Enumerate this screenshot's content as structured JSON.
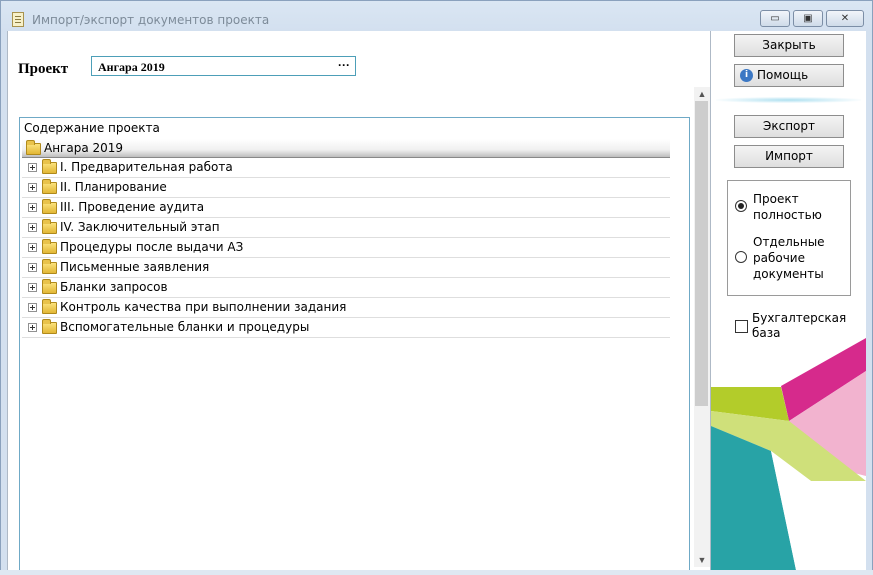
{
  "window": {
    "title": "Импорт/экспорт документов проекта",
    "controls": {
      "minimize": "▭",
      "maximize": "▣",
      "close": "✕"
    }
  },
  "project": {
    "label": "Проект",
    "value": "Ангара 2019",
    "browse": "···"
  },
  "tree": {
    "header": "Содержание проекта",
    "root": "Ангара 2019",
    "items": [
      "I. Предварительная работа",
      "II. Планирование",
      "III. Проведение аудита",
      "IV. Заключительный этап",
      "Процедуры после выдачи АЗ",
      "Письменные заявления",
      "Бланки запросов",
      "Контроль качества при выполнении задания",
      "Вспомогательные бланки  и процедуры"
    ]
  },
  "scroll": {
    "up": "▲",
    "down": "▼"
  },
  "buttons": {
    "close": "Закрыть",
    "help": "Помощь",
    "export": "Экспорт",
    "import": "Импорт"
  },
  "icons": {
    "info": "i"
  },
  "options": {
    "full_line1": "Проект",
    "full_line2": "полностью",
    "docs_line1": "Отдельные",
    "docs_line2": "рабочие",
    "docs_line3": "документы",
    "selected": "full"
  },
  "checkbox": {
    "line1": "Бухгалтерская",
    "line2": "база",
    "checked": false
  },
  "colors": {
    "accent_border": "#4d9fb8",
    "deco_magenta": "#d62a8c",
    "deco_pink": "#f2a2c6",
    "deco_lime": "#a8c62a",
    "deco_teal": "#2aa8a8"
  }
}
